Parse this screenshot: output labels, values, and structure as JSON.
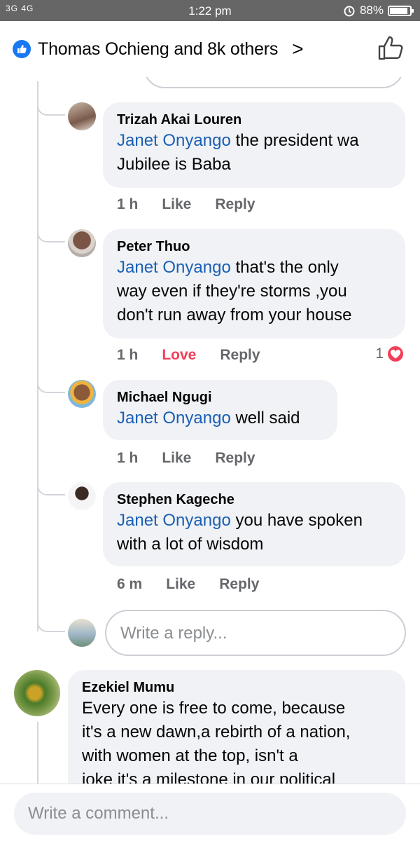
{
  "status_bar": {
    "network": "3G 4G",
    "time": "1:22 pm",
    "battery_percent": "88%",
    "battery_level": 0.88
  },
  "header": {
    "likes_text": "Thomas Ochieng and 8k others",
    "chevron": ">",
    "like_icon": "thumbs-up-icon"
  },
  "replies": [
    {
      "author": "Trizah Akai Louren",
      "mention": "Janet Onyango",
      "lines": [
        " the president wa",
        "Jubilee is Baba"
      ],
      "time": "1 h",
      "like_label": "Like",
      "reply_label": "Reply"
    },
    {
      "author": "Peter Thuo",
      "mention": "Janet Onyango",
      "lines": [
        " that's the only",
        "way even if they're storms ,you",
        "don't run away from your house"
      ],
      "time": "1 h",
      "like_label": "Love",
      "reply_label": "Reply",
      "reaction_count": "1",
      "reaction_icon": "heart-icon"
    },
    {
      "author": "Michael Ngugi",
      "mention": "Janet Onyango",
      "lines": [
        " well said"
      ],
      "time": "1 h",
      "like_label": "Like",
      "reply_label": "Reply"
    },
    {
      "author": "Stephen Kageche",
      "mention": "Janet Onyango",
      "lines": [
        " you have spoken",
        "with a lot of wisdom"
      ],
      "time": "6 m",
      "like_label": "Like",
      "reply_label": "Reply"
    }
  ],
  "reply_input": {
    "placeholder": "Write a reply..."
  },
  "comment": {
    "author": "Ezekiel Mumu",
    "lines": [
      "Every one is free to come, because",
      "it's a new dawn,a rebirth of a nation,",
      "with women at the top, isn't  a",
      "joke it's a milestone in our political"
    ]
  },
  "comment_input": {
    "placeholder": "Write a comment..."
  },
  "colors": {
    "accent": "#1877f2",
    "mention": "#1a5fb4",
    "love": "#f33e58",
    "bubble": "#f0f2f5",
    "meta": "#65676b"
  }
}
